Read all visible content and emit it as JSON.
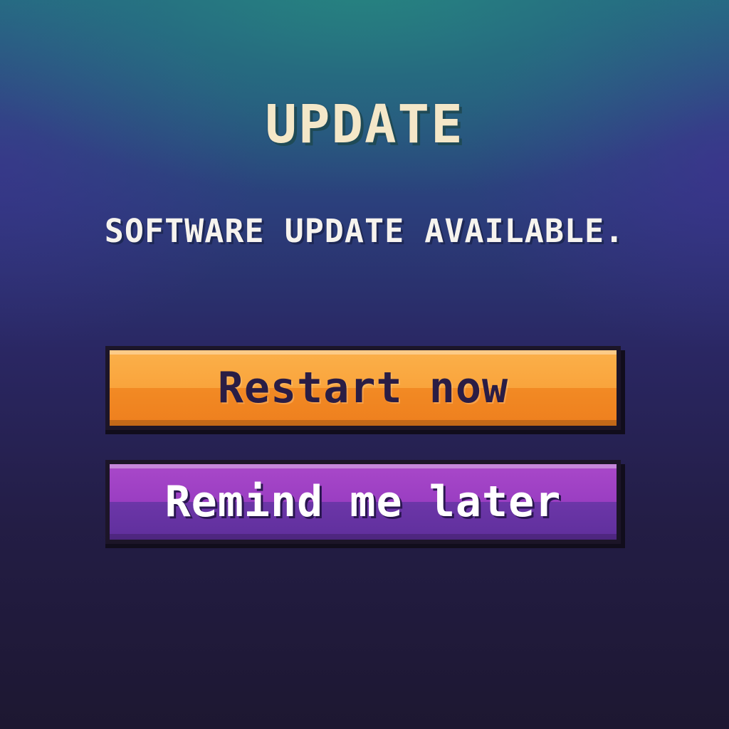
{
  "dialog": {
    "title": "UPDATE",
    "message": "SOFTWARE UPDATE AVAILABLE."
  },
  "buttons": {
    "restart": {
      "label": "Restart now",
      "color": "#F7962E"
    },
    "remind": {
      "label": "Remind me later",
      "color": "#8A3DBE"
    }
  },
  "colors": {
    "title": "#F4E7C8",
    "message": "#F6F3EE",
    "background_top": "#256A83",
    "background_bottom": "#1D1731"
  }
}
